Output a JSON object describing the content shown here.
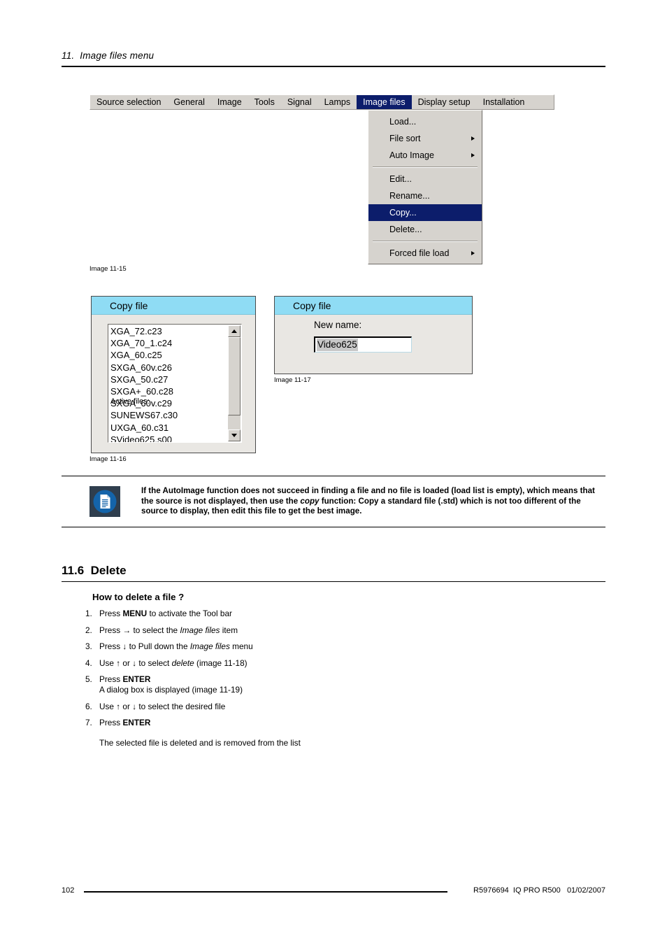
{
  "page_header": {
    "chapter": "11.  Image files menu"
  },
  "figure_11_15": {
    "caption": "Image 11-15",
    "menubar": {
      "items": [
        {
          "label": "Source selection",
          "active": false
        },
        {
          "label": "General",
          "active": false
        },
        {
          "label": "Image",
          "active": false
        },
        {
          "label": "Tools",
          "active": false
        },
        {
          "label": "Signal",
          "active": false
        },
        {
          "label": "Lamps",
          "active": false
        },
        {
          "label": "Image files",
          "active": true
        },
        {
          "label": "Display setup",
          "active": false
        },
        {
          "label": "Installation",
          "active": false
        }
      ]
    },
    "dropdown": {
      "items": [
        {
          "label": "Load...",
          "submenu": false,
          "selected": false,
          "separator_after": false
        },
        {
          "label": "File sort",
          "submenu": true,
          "selected": false,
          "separator_after": false
        },
        {
          "label": "Auto Image",
          "submenu": true,
          "selected": false,
          "separator_after": true
        },
        {
          "label": "Edit...",
          "submenu": false,
          "selected": false,
          "separator_after": false
        },
        {
          "label": "Rename...",
          "submenu": false,
          "selected": false,
          "separator_after": false
        },
        {
          "label": "Copy...",
          "submenu": false,
          "selected": true,
          "separator_after": false
        },
        {
          "label": "Delete...",
          "submenu": false,
          "selected": false,
          "separator_after": true
        },
        {
          "label": "Forced file load",
          "submenu": true,
          "selected": false,
          "separator_after": false
        }
      ]
    }
  },
  "figure_11_16": {
    "caption": "Image 11-16",
    "title": "Copy file",
    "overlay_label": "Active files:",
    "files": [
      "XGA_72.c23",
      "XGA_70_1.c24",
      "XGA_60.c25",
      "SXGA_60v.c26",
      "SXGA_50.c27",
      "SXGA+_60.c28",
      "SXGA_60v.c29",
      "SUNEWS67.c30",
      "UXGA_60.c31",
      "SVideo625.s00"
    ]
  },
  "figure_11_17": {
    "caption": "Image 11-17",
    "title": "Copy file",
    "field_label": "New name:",
    "field_value": "Video625"
  },
  "note": {
    "icon": "document-info-icon",
    "text_part1": "If the AutoImage function does not succeed in finding a file and no file is loaded (load list is empty), which means that the source is not displayed, then use the ",
    "text_italic": "copy",
    "text_part2": " function: Copy a standard file (.std) which is not too different of the source to display, then edit this file to get the best image."
  },
  "section": {
    "number_title": "11.6  Delete",
    "subsection_title": "How to delete a file ?",
    "steps": [
      {
        "num": "1.",
        "pre": "Press ",
        "bold": "MENU",
        "post": " to activate the Tool bar",
        "italic": "",
        "post2": "",
        "sub": ""
      },
      {
        "num": "2.",
        "pre": "Press → to select the ",
        "bold": "",
        "italic": "Image files",
        "post": " item",
        "post2": "",
        "sub": ""
      },
      {
        "num": "3.",
        "pre": "Press ↓ to Pull down the ",
        "bold": "",
        "italic": "Image files",
        "post": " menu",
        "post2": "",
        "sub": ""
      },
      {
        "num": "4.",
        "pre": "Use ↑ or ↓ to select ",
        "bold": "",
        "italic": "delete",
        "post": " (image 11-18)",
        "post2": "",
        "sub": ""
      },
      {
        "num": "5.",
        "pre": "Press ",
        "bold": "ENTER",
        "italic": "",
        "post": "",
        "post2": "",
        "sub": "A dialog box is displayed (image 11-19)"
      },
      {
        "num": "6.",
        "pre": "Use ↑ or ↓ to select the desired file",
        "bold": "",
        "italic": "",
        "post": "",
        "post2": "",
        "sub": ""
      },
      {
        "num": "7.",
        "pre": "Press ",
        "bold": "ENTER",
        "italic": "",
        "post": "",
        "post2": "",
        "sub": ""
      }
    ],
    "closing_text": "The selected file is deleted and is removed from the list"
  },
  "footer": {
    "page_number": "102",
    "meta": "R5976694  IQ PRO R500   01/02/2007"
  },
  "colors": {
    "menu_highlight": "#0c1d6b",
    "menu_face": "#d6d3ce",
    "dialog_titlebar": "#8fdcf4",
    "dialog_face": "#e9e7e3",
    "note_icon_bg": "#2f3e4e",
    "note_icon_circle": "#1464aa"
  }
}
